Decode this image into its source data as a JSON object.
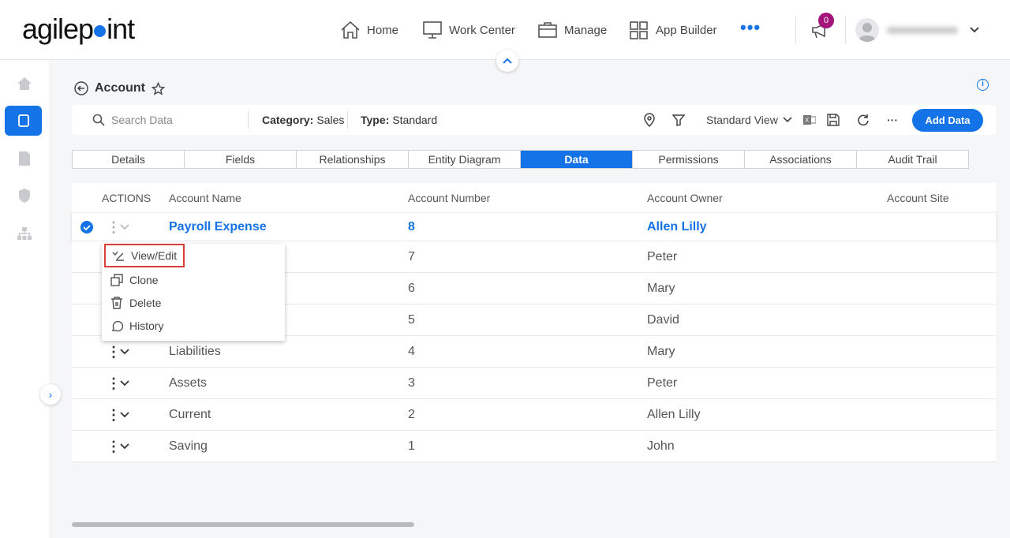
{
  "brand": {
    "logo_text": "agilepoint"
  },
  "nav": {
    "items": [
      {
        "label": "Home",
        "icon": "home-icon"
      },
      {
        "label": "Work Center",
        "icon": "monitor-icon"
      },
      {
        "label": "Manage",
        "icon": "briefcase-icon"
      },
      {
        "label": "App Builder",
        "icon": "grid-icon"
      }
    ],
    "more_icon": "more-horizontal-icon",
    "notifications_count": "0"
  },
  "page": {
    "title": "Account",
    "info_icon": "info-icon"
  },
  "toolbar": {
    "search_placeholder": "Search Data",
    "category_label": "Category:",
    "category_value": "Sales",
    "type_label": "Type:",
    "type_value": "Standard",
    "view_label": "Standard View",
    "add_button": "Add Data"
  },
  "tabs": [
    {
      "label": "Details"
    },
    {
      "label": "Fields"
    },
    {
      "label": "Relationships"
    },
    {
      "label": "Entity Diagram"
    },
    {
      "label": "Data",
      "active": true
    },
    {
      "label": "Permissions"
    },
    {
      "label": "Associations"
    },
    {
      "label": "Audit Trail"
    }
  ],
  "table": {
    "columns": [
      "ACTIONS",
      "Account Name",
      "Account Number",
      "Account Owner",
      "Account Site"
    ],
    "rows": [
      {
        "name": "Payroll Expense",
        "number": "8",
        "owner": "Allen Lilly",
        "selected": true
      },
      {
        "name": "",
        "number": "7",
        "owner": "Peter"
      },
      {
        "name": "",
        "number": "6",
        "owner": "Mary"
      },
      {
        "name": "",
        "number": "5",
        "owner": "David"
      },
      {
        "name": "Liabilities",
        "number": "4",
        "owner": "Mary"
      },
      {
        "name": "Assets",
        "number": "3",
        "owner": "Peter"
      },
      {
        "name": "Current",
        "number": "2",
        "owner": "Allen Lilly"
      },
      {
        "name": "Saving",
        "number": "1",
        "owner": "John"
      }
    ]
  },
  "context_menu": {
    "items": [
      {
        "label": "View/Edit",
        "highlighted": true
      },
      {
        "label": "Clone"
      },
      {
        "label": "Delete"
      },
      {
        "label": "History"
      }
    ]
  },
  "colors": {
    "accent": "#1473e6",
    "badge": "#a3157a",
    "highlight": "#d9403a"
  }
}
